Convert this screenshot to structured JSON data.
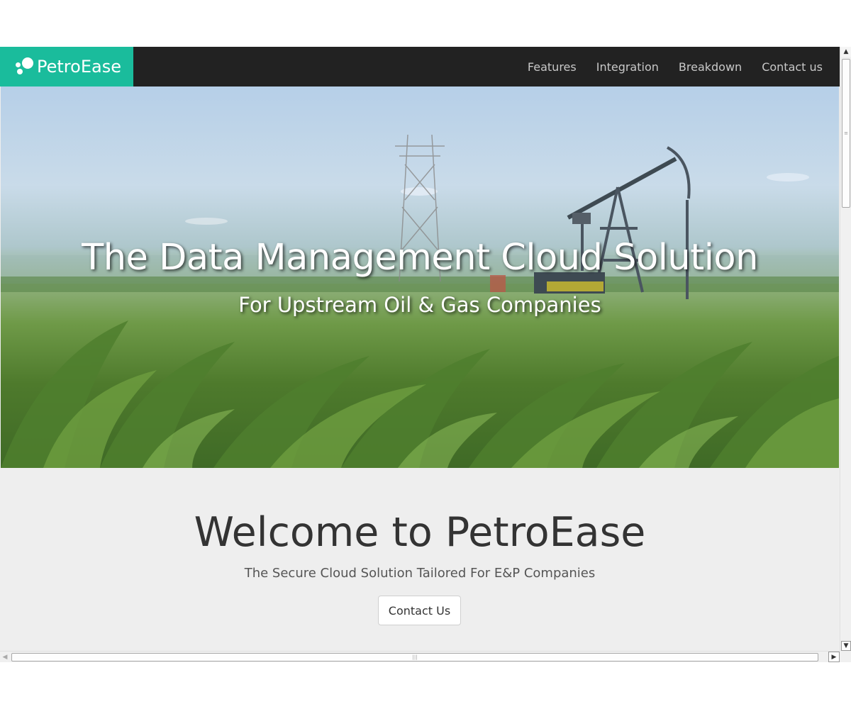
{
  "brand": {
    "name": "PetroEase"
  },
  "nav": {
    "items": [
      {
        "label": "Features"
      },
      {
        "label": "Integration"
      },
      {
        "label": "Breakdown"
      },
      {
        "label": "Contact us"
      }
    ]
  },
  "hero": {
    "title": "The Data Management Cloud Solution",
    "subtitle": "For Upstream Oil & Gas Companies"
  },
  "welcome": {
    "title": "Welcome to PetroEase",
    "subtitle": "The Secure Cloud Solution Tailored For E&P Companies",
    "button_label": "Contact Us"
  },
  "colors": {
    "navbar_bg": "#222222",
    "brand_bg": "#1abc9c",
    "section_bg": "#eeeeee"
  }
}
